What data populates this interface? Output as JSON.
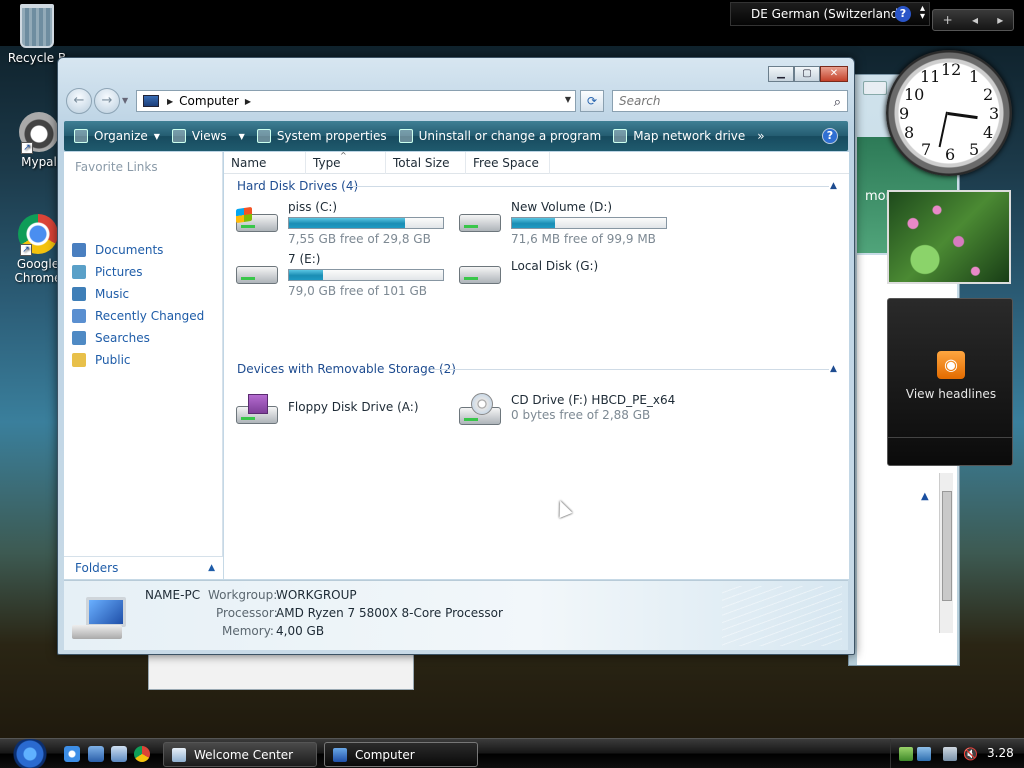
{
  "desktop": {
    "icons": [
      {
        "label": "Recycle B"
      },
      {
        "label": "Mypal"
      },
      {
        "label": "Google Chrome"
      }
    ],
    "language_bar": {
      "label": "DE German (Switzerland)",
      "help": "?"
    },
    "sidebar_controls": {
      "add": "+",
      "prev": "◂",
      "next": "▸"
    },
    "feed_gadget": {
      "label": "View headlines"
    },
    "background_window_text": "more"
  },
  "explorer": {
    "address": {
      "crumb": "Computer"
    },
    "search": {
      "placeholder": "Search"
    },
    "toolbar": {
      "items": [
        {
          "label": "Organize"
        },
        {
          "label": "Views"
        },
        {
          "label": "System properties"
        },
        {
          "label": "Uninstall or change a program"
        },
        {
          "label": "Map network drive"
        }
      ],
      "more": "»",
      "help": "?"
    },
    "nav_pane": {
      "title": "Favorite Links",
      "links": [
        {
          "label": "Documents",
          "color": "#4a7fc0"
        },
        {
          "label": "Pictures",
          "color": "#5aa0c8"
        },
        {
          "label": "Music",
          "color": "#3f7fb8"
        },
        {
          "label": "Recently Changed",
          "color": "#5a8fd0"
        },
        {
          "label": "Searches",
          "color": "#4f8ac4"
        },
        {
          "label": "Public",
          "color": "#e8c04a"
        }
      ],
      "folders_label": "Folders"
    },
    "columns": [
      "Name",
      "Type",
      "Total Size",
      "Free Space"
    ],
    "groups": [
      {
        "title": "Hard Disk Drives (4)",
        "drives": [
          {
            "name": "piss (C:)",
            "free": "7,55 GB free of 29,8 GB",
            "used_fraction": 0.75
          },
          {
            "name": "New Volume (D:)",
            "free": "71,6 MB free of 99,9 MB",
            "used_fraction": 0.28
          },
          {
            "name": "7 (E:)",
            "free": "79,0 GB free of 101 GB",
            "used_fraction": 0.22
          },
          {
            "name": "Local Disk (G:)",
            "free": ""
          }
        ]
      },
      {
        "title": "Devices with Removable Storage (2)",
        "drives": [
          {
            "name": "Floppy Disk Drive (A:)",
            "free": ""
          },
          {
            "name": "CD Drive (F:) HBCD_PE_x64",
            "free": "0 bytes free of 2,88 GB"
          }
        ]
      }
    ],
    "details": {
      "computer_name": "NAME-PC",
      "workgroup_label": "Workgroup:",
      "workgroup": "WORKGROUP",
      "processor_label": "Processor:",
      "processor": "AMD Ryzen 7 5800X 8-Core Processor",
      "memory_label": "Memory:",
      "memory": "4,00 GB"
    }
  },
  "taskbar": {
    "tasks": [
      {
        "label": "Welcome Center"
      },
      {
        "label": "Computer"
      }
    ],
    "clock": "3.28"
  }
}
